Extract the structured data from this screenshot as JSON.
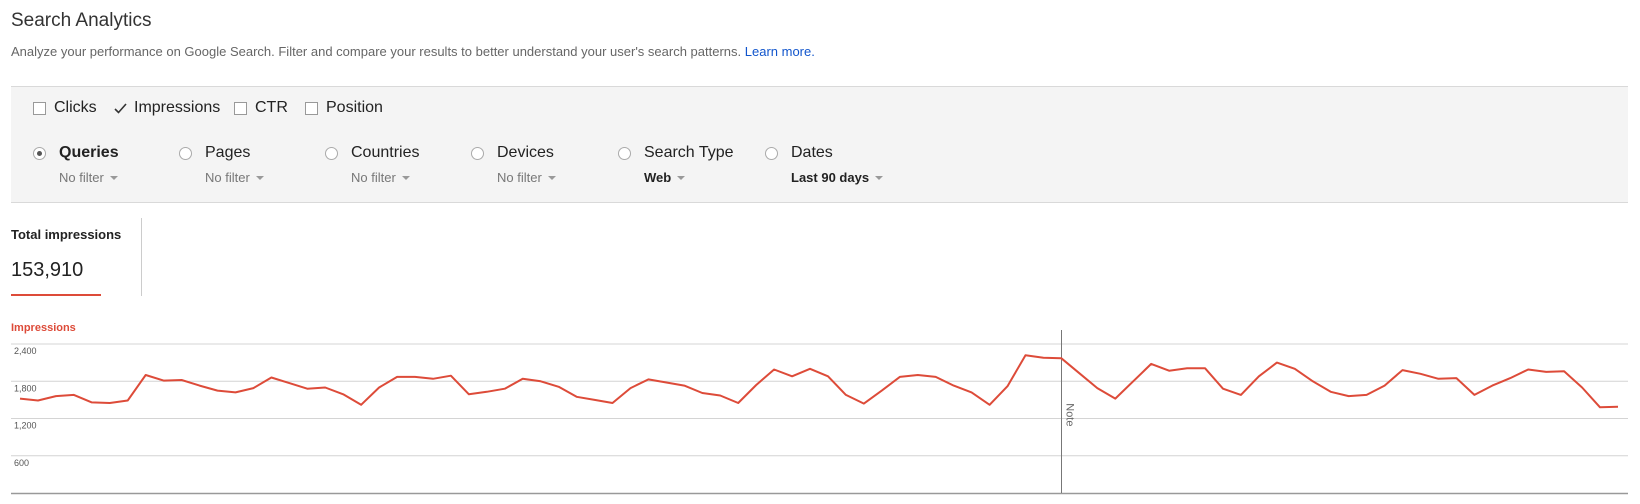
{
  "header": {
    "title": "Search Analytics",
    "subtitle": "Analyze your performance on Google Search. Filter and compare your results to better understand your user's search patterns.",
    "learn_more": "Learn more."
  },
  "metrics": [
    {
      "label": "Clicks",
      "checked": false
    },
    {
      "label": "Impressions",
      "checked": true
    },
    {
      "label": "CTR",
      "checked": false
    },
    {
      "label": "Position",
      "checked": false
    }
  ],
  "dimensions": [
    {
      "label": "Queries",
      "filter": "No filter",
      "selected": true
    },
    {
      "label": "Pages",
      "filter": "No filter",
      "selected": false
    },
    {
      "label": "Countries",
      "filter": "No filter",
      "selected": false
    },
    {
      "label": "Devices",
      "filter": "No filter",
      "selected": false
    },
    {
      "label": "Search Type",
      "filter": "Web",
      "selected": false
    },
    {
      "label": "Dates",
      "filter": "Last 90 days",
      "selected": false
    }
  ],
  "summary": {
    "label": "Total impressions",
    "value": "153,910"
  },
  "colors": {
    "accent": "#dd4b39",
    "link": "#1155cc"
  },
  "chart_data": {
    "type": "line",
    "title": "Impressions",
    "ylim": [
      0,
      2400
    ],
    "yticks": [
      "2,400",
      "1,800",
      "1,200",
      "600"
    ],
    "grid": true,
    "annotations": [
      {
        "label": "Note",
        "index": 58
      }
    ],
    "series": [
      {
        "name": "Impressions",
        "values": [
          1520,
          1490,
          1560,
          1580,
          1460,
          1450,
          1490,
          1900,
          1810,
          1820,
          1730,
          1650,
          1620,
          1690,
          1860,
          1770,
          1680,
          1700,
          1590,
          1420,
          1700,
          1870,
          1870,
          1840,
          1890,
          1590,
          1630,
          1680,
          1840,
          1800,
          1710,
          1550,
          1500,
          1450,
          1690,
          1830,
          1780,
          1730,
          1610,
          1570,
          1450,
          1740,
          1990,
          1880,
          2000,
          1880,
          1580,
          1440,
          1650,
          1870,
          1900,
          1870,
          1730,
          1620,
          1420,
          1720,
          2220,
          2180,
          2170,
          1930,
          1690,
          1520,
          1800,
          2080,
          1970,
          2010,
          2010,
          1680,
          1580,
          1880,
          2100,
          2000,
          1800,
          1630,
          1560,
          1580,
          1730,
          1980,
          1920,
          1840,
          1850,
          1580,
          1730,
          1850,
          1990,
          1950,
          1960,
          1700,
          1380,
          1390
        ]
      }
    ]
  }
}
